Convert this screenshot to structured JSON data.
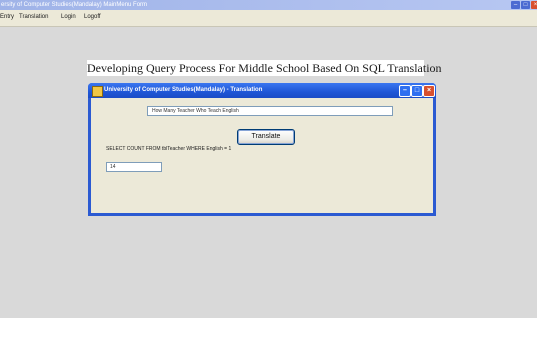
{
  "mdi": {
    "title": "ersity of Computer Studies(Mandalay) MainMenu Form",
    "controls": [
      "–",
      "□",
      "×"
    ],
    "menu": [
      "Entry",
      "Translation",
      "Login",
      "Logoff"
    ]
  },
  "banner": "Developing Query Process For Middle School Based On SQL Translation",
  "child": {
    "title": "University of Computer Studies(Mandalay) - Translation",
    "icon": "app-icon",
    "controls": [
      "–",
      "□",
      "×"
    ],
    "query_value": "How Many Teacher Who Teach English",
    "translate_label": "Translate",
    "sql": "SELECT COUNT FROM tblTeacher WHERE English = 1",
    "result_value": "14"
  },
  "colors": {
    "desktop": "#d9d9d9",
    "titlebar": "#1f56d6",
    "close": "#d8502e"
  }
}
